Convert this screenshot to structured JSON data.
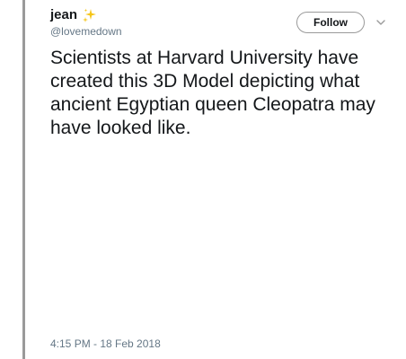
{
  "user": {
    "display_name": "jean",
    "emoji_icon": "sparkles-icon",
    "handle": "@lovemedown"
  },
  "actions": {
    "follow_label": "Follow",
    "more_icon": "chevron-down-icon"
  },
  "tweet": {
    "text": "Scientists at Harvard University have created this 3D Model depicting what ancient Egyptian queen Cleopatra may have looked like.",
    "timestamp": "4:15 PM - 18 Feb 2018"
  },
  "colors": {
    "quote_bar": "#9a9a9a",
    "text": "#14171a",
    "secondary_text": "#657786",
    "sparkle": "#f5c518"
  }
}
